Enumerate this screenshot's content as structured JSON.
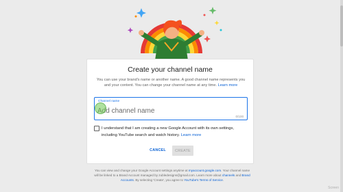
{
  "dialog": {
    "title": "Create your channel name",
    "description": "You can use your brand's name or another name. A good channel name represents you and your content. You can change your channel name at any time.",
    "description_learn_more": "Learn more",
    "field": {
      "label": "Channel name",
      "placeholder": "Add channel name",
      "value": "",
      "counter": "0/100"
    },
    "consent": {
      "checked": false,
      "text": "I understand that I am creating a new Google Account with its own settings, including YouTube search and watch history.",
      "learn_more": "Learn more"
    },
    "cancel_label": "CANCEL",
    "create_label": "CREATE"
  },
  "footer": {
    "text_1": "You can view and change your Google Account settings anytime at",
    "link_account": "myaccount.google.com",
    "text_2": ". Your channel name will be linked to a Brand Account managed by zubledesigns@gmail.com. Learn more about",
    "link_channels": "channels",
    "text_3": "and",
    "link_brand": "Brand Accounts",
    "text_4": ". By selecting 'Create', you agree to",
    "link_terms": "YouTube's Terms of Service",
    "text_5": "."
  },
  "watermark": "Screen",
  "icons": {
    "illustration": "rainbow-person-illustration",
    "scrollbar": "scrollbar"
  },
  "colors": {
    "accent": "#065fd4",
    "field_border": "#1a73e8",
    "disabled_button_bg": "#e0e0e0",
    "cursor_highlight": "#6ec850"
  }
}
